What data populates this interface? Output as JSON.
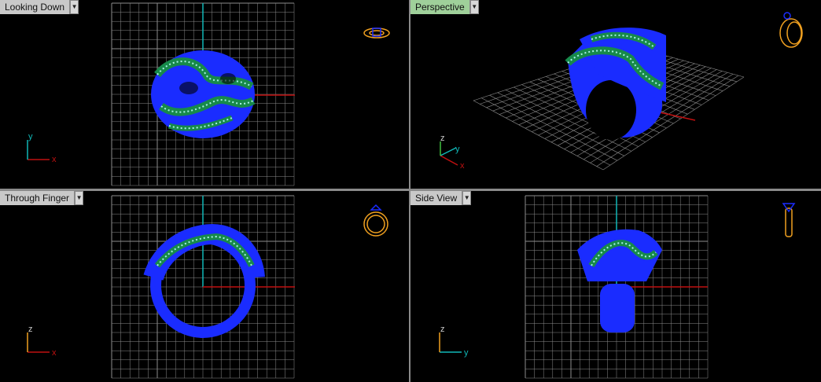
{
  "viewports": [
    {
      "title": "Looking Down",
      "axes": [
        "y",
        "x"
      ],
      "widget": "ring-top-icon"
    },
    {
      "title": "Perspective",
      "axes": [
        "z",
        "y",
        "x"
      ],
      "widget": "ring-persp-icon"
    },
    {
      "title": "Through Finger",
      "axes": [
        "z",
        "x"
      ],
      "widget": "ring-front-icon"
    },
    {
      "title": "Side View",
      "axes": [
        "z",
        "y"
      ],
      "widget": "ring-side-icon"
    }
  ],
  "colors": {
    "grid": "#8c8c8c",
    "ring_blue": "#1a2cff",
    "ring_green": "#178a4a",
    "gem_cyan": "#a7f0e6",
    "x_axis": "#c01010",
    "y_axis": "#10b7b7",
    "icon": "#f0a020",
    "active_title": "#9fd09a"
  }
}
